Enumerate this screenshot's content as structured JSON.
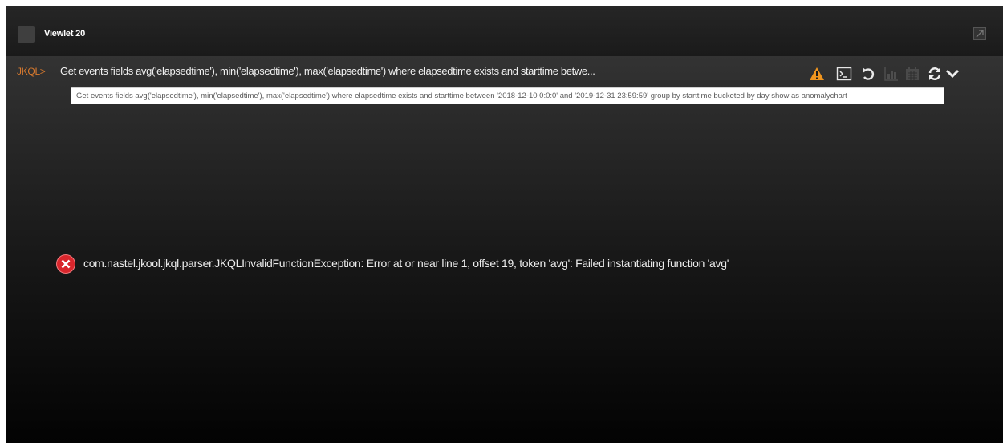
{
  "viewlet": {
    "title": "Viewlet 20"
  },
  "query": {
    "prompt": "JKQL>",
    "text": "Get events fields avg('elapsedtime'), min('elapsedtime'), max('elapsedtime') where elapsedtime exists and starttime betwe..."
  },
  "tooltip": {
    "text": "Get events fields avg('elapsedtime'), min('elapsedtime'), max('elapsedtime') where elapsedtime exists and starttime between '2018-12-10 0:0:0' and '2019-12-31 23:59:59' group by starttime bucketed by day show as anomalychart"
  },
  "toolbar": {
    "icons": [
      "warning-icon",
      "console-icon",
      "undo-icon",
      "chart-icon",
      "calendar-icon",
      "refresh-icon",
      "chevron-down-icon"
    ]
  },
  "error": {
    "message": "com.nastel.jkool.jkql.parser.JKQLInvalidFunctionException: Error at or near line 1, offset 19, token 'avg': Failed instantiating function 'avg'"
  },
  "colors": {
    "prompt": "#d7792e",
    "warning": "#f0951e",
    "error": "#d9262c"
  }
}
